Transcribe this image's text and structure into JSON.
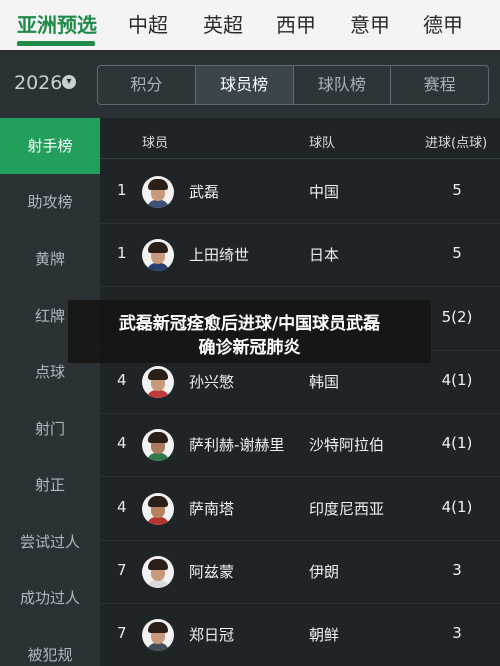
{
  "colors": {
    "accent": "#22a05b",
    "league_active": "#1f8a4a",
    "background": "#1f2427",
    "panel": "#2b3236"
  },
  "top_tabs": [
    "亚洲预选",
    "中超",
    "英超",
    "西甲",
    "意甲",
    "德甲"
  ],
  "season": {
    "label": "2026",
    "icon": "chevron-down-icon"
  },
  "segments": [
    "积分",
    "球员榜",
    "球队榜",
    "赛程"
  ],
  "sidebar": [
    "射手榜",
    "助攻榜",
    "黄牌",
    "红牌",
    "点球",
    "射门",
    "射正",
    "尝试过人",
    "成功过人",
    "被犯规"
  ],
  "table": {
    "headers": {
      "player": "球员",
      "team": "球队",
      "goals": "进球(点球)"
    },
    "rows": [
      {
        "rank": "1",
        "name": "武磊",
        "team": "中国",
        "goals": "5"
      },
      {
        "rank": "1",
        "name": "上田绮世",
        "team": "日本",
        "goals": "5"
      },
      {
        "rank": "",
        "name": "",
        "team": "",
        "goals": "5(2)"
      },
      {
        "rank": "4",
        "name": "孙兴慜",
        "team": "韩国",
        "goals": "4(1)"
      },
      {
        "rank": "4",
        "name": "萨利赫-谢赫里",
        "team": "沙特阿拉伯",
        "goals": "4(1)"
      },
      {
        "rank": "4",
        "name": "萨南塔",
        "team": "印度尼西亚",
        "goals": "4(1)"
      },
      {
        "rank": "7",
        "name": "阿兹蒙",
        "team": "伊朗",
        "goals": "3"
      },
      {
        "rank": "7",
        "name": "郑日冠",
        "team": "朝鲜",
        "goals": "3"
      }
    ]
  },
  "headline": {
    "line1": "武磊新冠痊愈后进球/中国球员武磊",
    "line2": "确诊新冠肺炎"
  }
}
